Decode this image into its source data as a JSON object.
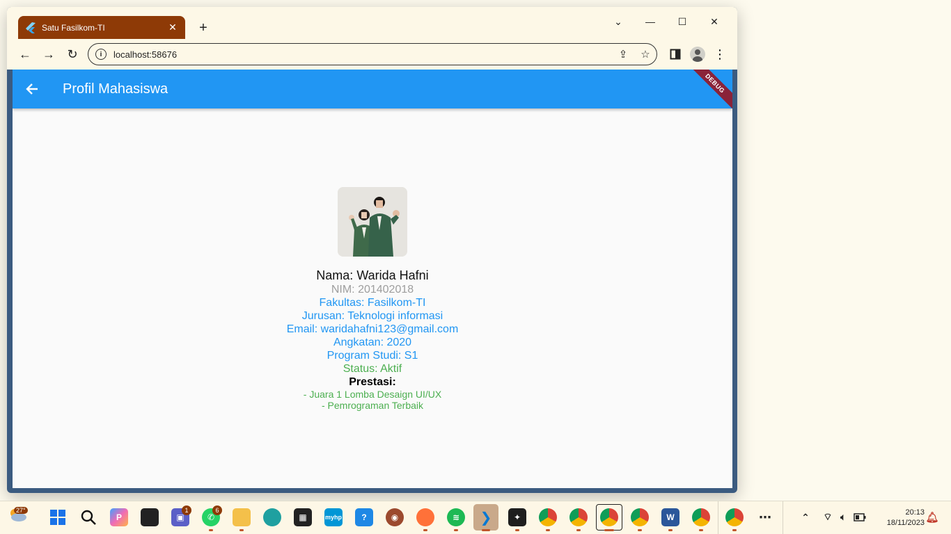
{
  "browser": {
    "tab_title": "Satu Fasilkom-TI",
    "url": "localhost:58676"
  },
  "app": {
    "appbar_title": "Profil Mahasiswa",
    "debug_banner": "DEBUG",
    "profile": {
      "nama": "Nama: Warida Hafni",
      "nim": "NIM: 201402018",
      "fakultas": "Fakultas: Fasilkom-TI",
      "jurusan": "Jurusan: Teknologi informasi",
      "email": "Email: waridahafni123@gmail.com",
      "angkatan": "Angkatan: 2020",
      "program_studi": "Program Studi: S1",
      "status": "Status: Aktif",
      "prestasi_label": "Prestasi:",
      "prestasi_items": [
        "- Juara 1 Lomba Desaign UI/UX",
        "- Pemrograman Terbaik"
      ]
    }
  },
  "taskbar": {
    "weather": "27°",
    "teams_badge": "1",
    "whatsapp_badge": "6",
    "time": "20:13",
    "date": "18/11/2023"
  },
  "colors": {
    "appbar": "#2196f3",
    "tab": "#8e3a06",
    "grey_text": "#9e9e9e",
    "green_text": "#4caf50"
  }
}
